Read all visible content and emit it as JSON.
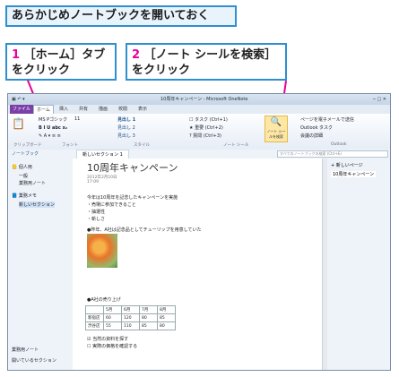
{
  "heading": "あらかじめノートブックを開いておく",
  "steps": [
    {
      "num": "1",
      "line1": "［ホーム］タブ",
      "line2": "をクリック"
    },
    {
      "num": "2",
      "line1": "［ノート シールを検索］",
      "line2": "をクリック"
    }
  ],
  "window": {
    "title": "10周年キャンペーン - Microsoft OneNote",
    "tabs": [
      "ファイル",
      "ホーム",
      "挿入",
      "共有",
      "描画",
      "校閲",
      "表示"
    ],
    "ribbon": {
      "font_name": "MS Pゴシック",
      "font_size": "11",
      "styles": [
        "見出し 1",
        "見出し 2",
        "見出し 3"
      ],
      "tags": [
        "タスク (Ctrl+1)",
        "重要 (Ctrl+2)",
        "質問 (Ctrl+3)"
      ],
      "find_tags": "ノート シールを検索",
      "outlook": [
        "ページを電子メールで送信",
        "Outlook タスク",
        "会議の詳細"
      ],
      "groups": [
        "クリップボード",
        "フォント",
        "スタイル",
        "ノート シール",
        "Outlook"
      ]
    },
    "nav": {
      "notebooks_label": "ノートブック",
      "section_tab": "新しいセクション 1",
      "search_placeholder": "すべてのノートブックの検索 (Ctrl+E)"
    },
    "sidebar": {
      "items": [
        "個人用",
        "一般",
        "業務用ノート",
        "業務メモ",
        "新しいセクション"
      ],
      "bottom": [
        "業務用ノート",
        "開いているセクション"
      ]
    },
    "page": {
      "title": "10周年キャンペーン",
      "date": "2012年2月10日",
      "time": "17:09",
      "lines": [
        "今年は10周年を記念したキャンペーンを実施",
        "・売場に参加できること",
        "・抽選性",
        "・新しさ"
      ],
      "photo_note": "●昨年、A社は記念品としてチューリップを用意していた",
      "sales_heading": "●A社の売り上げ",
      "table": {
        "headers": [
          "",
          "5月",
          "6月",
          "7月",
          "8月"
        ],
        "rows": [
          [
            "新宿店",
            "60",
            "120",
            "80",
            "85"
          ],
          [
            "渋谷店",
            "55",
            "110",
            "85",
            "80"
          ]
        ]
      },
      "todos": [
        "当然の資料を探す",
        "実際の価格を確認する"
      ]
    },
    "page_list": {
      "new_page": "新しいページ",
      "item": "10周年キャンペーン"
    }
  }
}
